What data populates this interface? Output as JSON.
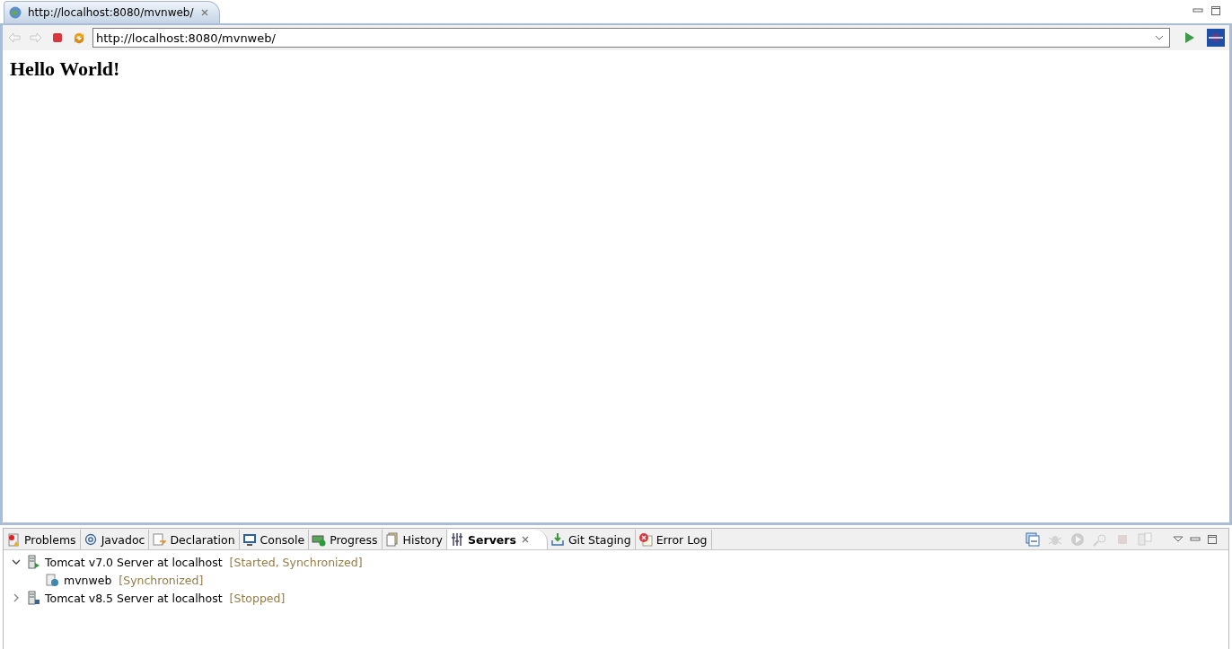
{
  "editor": {
    "tab": {
      "title": "http://localhost:8080/mvnweb/",
      "selected": true
    },
    "nav_buttons": [
      {
        "disabled": true
      },
      {
        "disabled": true
      },
      {
        "disabled": false
      },
      {
        "disabled": false
      }
    ],
    "address": {
      "value": "http://localhost:8080/mvnweb/"
    },
    "page": {
      "heading": "Hello World!"
    }
  },
  "panel": {
    "tabs": [
      {
        "label": "Problems",
        "selected": false
      },
      {
        "label": "Javadoc",
        "selected": false
      },
      {
        "label": "Declaration",
        "selected": false
      },
      {
        "label": "Console",
        "selected": false
      },
      {
        "label": "Progress",
        "selected": false
      },
      {
        "label": "History",
        "selected": false
      },
      {
        "label": "Servers",
        "selected": true
      },
      {
        "label": "Git Staging",
        "selected": false
      },
      {
        "label": "Error Log",
        "selected": false
      }
    ],
    "actions": [
      {
        "disabled": false
      },
      {
        "disabled": true
      },
      {
        "disabled": true
      },
      {
        "disabled": true
      },
      {
        "disabled": true
      },
      {
        "disabled": true
      }
    ],
    "servers": [
      {
        "name": "Tomcat v7.0 Server at localhost",
        "status": "[Started, Synchronized]",
        "expanded": true,
        "running": true,
        "children": [
          {
            "name": "mvnweb",
            "status": "[Synchronized]"
          }
        ]
      },
      {
        "name": "Tomcat v8.5 Server at localhost",
        "status": "[Stopped]",
        "expanded": false,
        "running": false
      }
    ]
  }
}
